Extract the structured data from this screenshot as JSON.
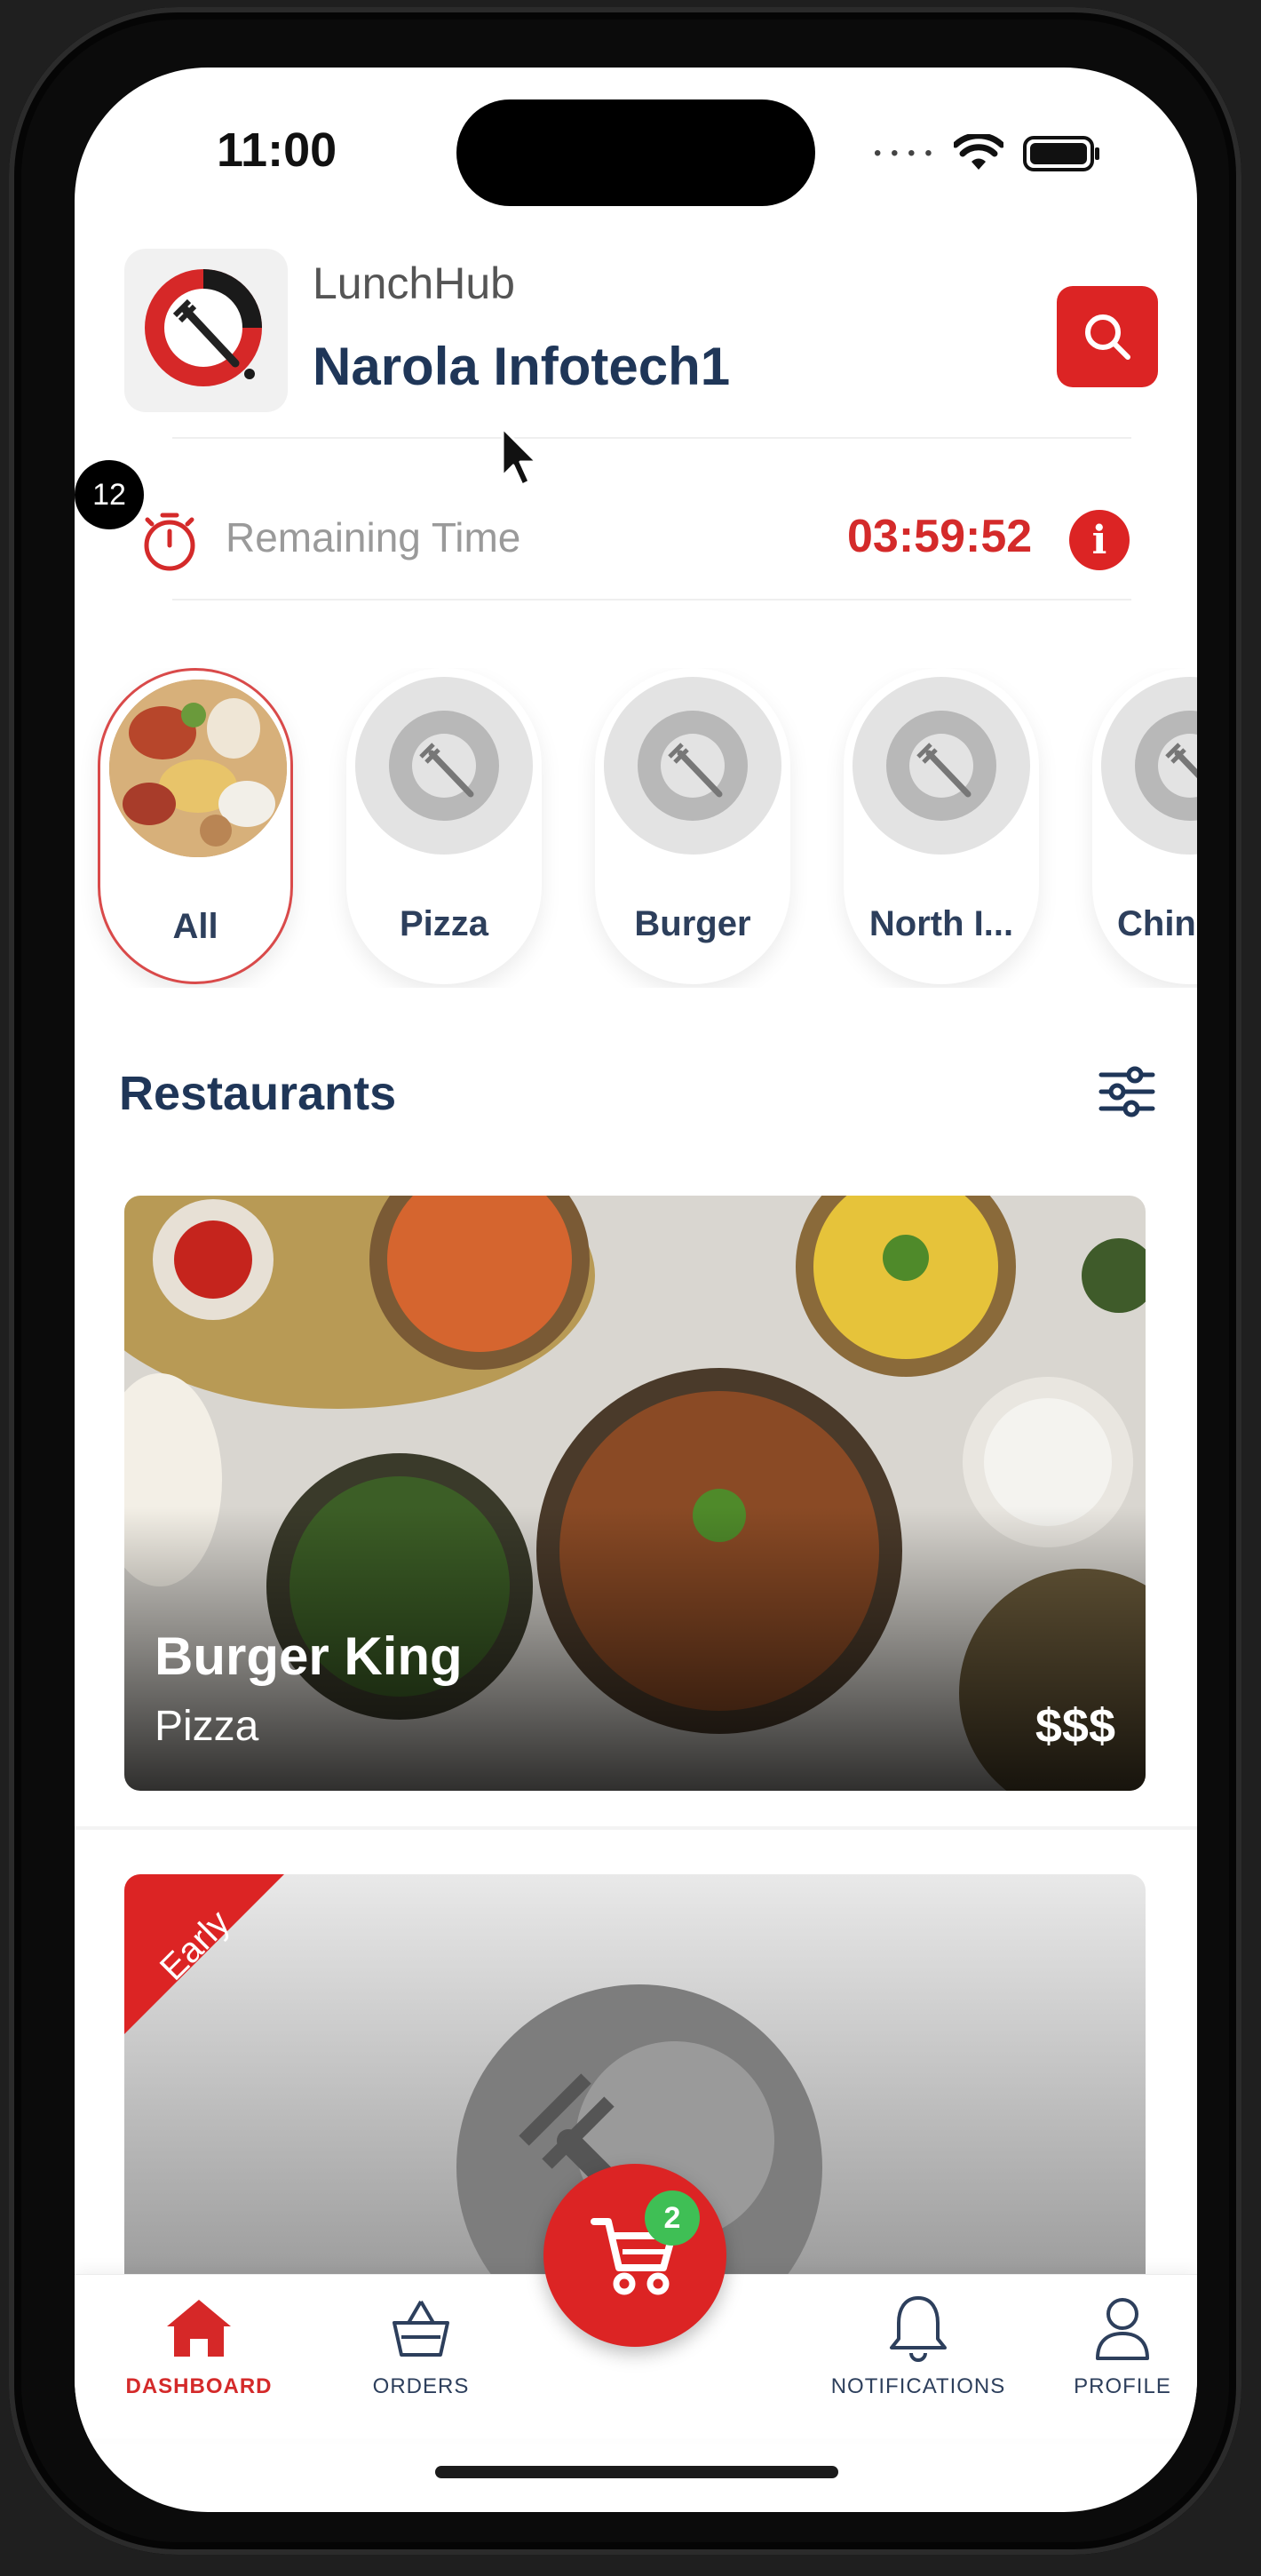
{
  "status_bar": {
    "time": "11:00"
  },
  "header": {
    "app_name": "LunchHub",
    "company_name": "Narola Infotech1"
  },
  "badge": {
    "count": "12"
  },
  "timer": {
    "label": "Remaining Time",
    "value": "03:59:52"
  },
  "categories": [
    {
      "label": "All",
      "selected": true
    },
    {
      "label": "Pizza",
      "selected": false
    },
    {
      "label": "Burger",
      "selected": false
    },
    {
      "label": "North I...",
      "selected": false
    },
    {
      "label": "Chin",
      "selected": false
    }
  ],
  "restaurants_section": {
    "title": "Restaurants"
  },
  "restaurants": [
    {
      "name": "Burger King",
      "category": "Pizza",
      "price": "$$$"
    },
    {
      "ribbon": "Early"
    }
  ],
  "cart": {
    "count": "2"
  },
  "bottom_nav": [
    {
      "label": "DASHBOARD",
      "icon": "home-icon",
      "active": true
    },
    {
      "label": "ORDERS",
      "icon": "basket-icon",
      "active": false
    },
    {
      "label": "NOTIFICATIONS",
      "icon": "bell-icon",
      "active": false
    },
    {
      "label": "PROFILE",
      "icon": "user-icon",
      "active": false
    }
  ],
  "colors": {
    "accent": "#dc2424",
    "title_navy": "#1f3658",
    "badge_green": "#3fbf55"
  }
}
